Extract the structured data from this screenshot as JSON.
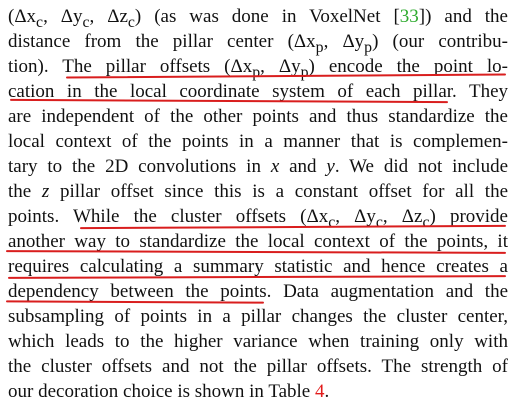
{
  "paragraph": {
    "lines": [
      {
        "pre": "(Δx",
        "sub": "c",
        "mid": ", Δy",
        "sub2": "c",
        "mid2": ", Δz",
        "sub3": "c",
        "post": ") (as was done in VoxelNet [",
        "ref": "33",
        "tail": "]) and the"
      },
      {
        "text": "distance from the pillar center (Δx",
        "sub": "p",
        "mid": ", Δy",
        "sub2": "p",
        "tail": ") (our contribu-"
      },
      {
        "text": "tion).  The pillar offsets (Δx",
        "sub": "p",
        "mid": ", Δy",
        "sub2": "p",
        "tail": ") encode the point lo-"
      },
      {
        "text": "cation in the local coordinate system of each pillar.  They"
      },
      {
        "text": "are independent of the other points and thus standardize the"
      },
      {
        "text": "local context of the points in a manner that is complemen-"
      },
      {
        "text": "tary to the 2D convolutions in ",
        "var1": "x",
        "mid": " and ",
        "var2": "y",
        "tail": ".  We did not include"
      },
      {
        "text": "the ",
        "var1": "z",
        "tail": " pillar offset since this is a constant offset for all the"
      },
      {
        "text": "points.  While the cluster offsets (Δx",
        "sub": "c",
        "mid": ", Δy",
        "sub2": "c",
        "mid2": ", Δz",
        "sub3": "c",
        "tail": ") provide"
      },
      {
        "text": "another way to standardize the local context of the points, it"
      },
      {
        "text": "requires calculating a summary statistic and hence creates a"
      },
      {
        "text": "dependency between the points.  Data augmentation and the"
      },
      {
        "text": "subsampling of points in a pillar changes the cluster center,"
      },
      {
        "text": "which leads to the higher variance when training only with"
      },
      {
        "text": "the cluster offsets and not the pillar offsets.  The strength of"
      },
      {
        "text": "our decoration choice is shown in Table ",
        "tref": "4",
        "tail": "."
      }
    ]
  },
  "colors": {
    "text": "#111111",
    "citation": "#2eaa2e",
    "table_ref": "#e21b1b",
    "underline": "#d91e1e"
  }
}
